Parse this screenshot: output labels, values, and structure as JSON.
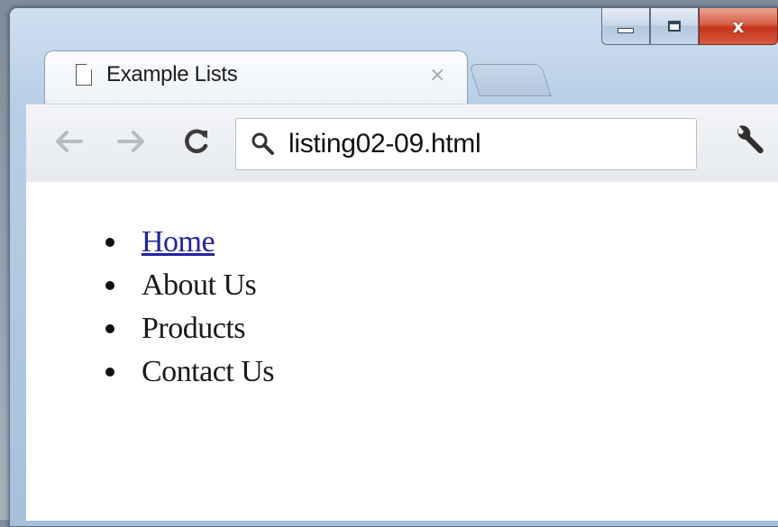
{
  "window": {
    "buttons": {
      "minimize_icon": "minimize-icon",
      "maximize_icon": "maximize-icon",
      "close_label": "x"
    }
  },
  "tab": {
    "title": "Example Lists",
    "close_label": "×",
    "icon": "document-icon"
  },
  "toolbar": {
    "back_icon": "back-arrow-icon",
    "forward_icon": "forward-arrow-icon",
    "reload_icon": "reload-icon",
    "address": "listing02-09.html",
    "search_icon": "search-icon",
    "menu_icon": "wrench-icon"
  },
  "page": {
    "list": [
      {
        "label": "Home",
        "link": true
      },
      {
        "label": "About Us",
        "link": false
      },
      {
        "label": "Products",
        "link": false
      },
      {
        "label": "Contact Us",
        "link": false
      }
    ]
  },
  "colors": {
    "link": "#2323a8",
    "close_button": "#c7331b",
    "titlebar": "#b9cfe6"
  }
}
